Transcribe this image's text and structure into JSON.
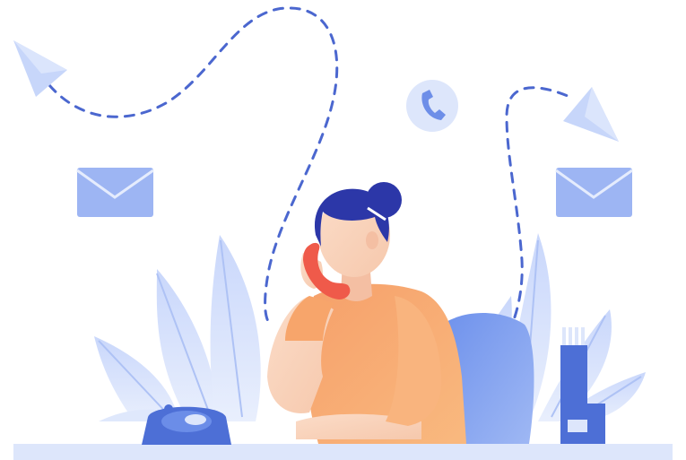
{
  "scene": {
    "subject": "customer-support-agent-on-phone",
    "icons": [
      "paper-plane-icon",
      "phone-icon",
      "mail-icon",
      "desk-phone-icon",
      "file-holder-icon"
    ],
    "colors": {
      "accent_blue": "#4d6fd6",
      "light_blue": "#c4d4fb",
      "dash_blue": "#4b67cf",
      "skin": "#fbd7c0",
      "shirt": "#f7a56b",
      "hair": "#2c37a8",
      "receiver_red": "#ef5a4a",
      "desk": "#dde6fb",
      "background": "#ffffff"
    }
  }
}
